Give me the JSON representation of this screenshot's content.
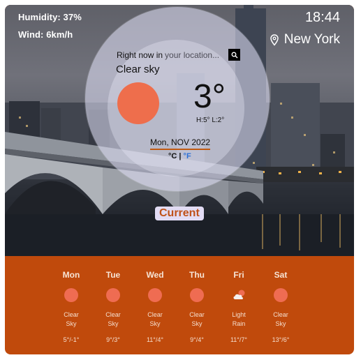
{
  "header": {
    "humidity": "Humidity: 37%",
    "wind": "Wind: 6km/h",
    "time": "18:44",
    "city": "New York",
    "location_icon": "map-pin-icon"
  },
  "current": {
    "search_label": "Right now in",
    "search_placeholder": "your location...",
    "search_icon": "search-icon",
    "condition": "Clear sky",
    "temperature": "3°",
    "hi_lo": "H:5° L:2°",
    "date": "Mon, NOV 2022",
    "unit_c": "°C",
    "unit_sep": "|",
    "unit_f": "°F",
    "button": "Current"
  },
  "colors": {
    "accent": "#c04a0c",
    "sun": "#ee6e4c",
    "unit_f": "#2b6fd6"
  },
  "forecast": [
    {
      "day": "Mon",
      "desc_1": "Clear",
      "desc_2": "Sky",
      "temp": "5°/-1°",
      "icon": "sun-icon"
    },
    {
      "day": "Tue",
      "desc_1": "Clear",
      "desc_2": "Sky",
      "temp": "9°/3°",
      "icon": "sun-icon"
    },
    {
      "day": "Wed",
      "desc_1": "Clear",
      "desc_2": "Sky",
      "temp": "11°/4°",
      "icon": "sun-icon"
    },
    {
      "day": "Thu",
      "desc_1": "Clear",
      "desc_2": "Sky",
      "temp": "9°/4°",
      "icon": "sun-icon"
    },
    {
      "day": "Fri",
      "desc_1": "Light",
      "desc_2": "Rain",
      "temp": "11°/7°",
      "icon": "cloud-sun-icon"
    },
    {
      "day": "Sat",
      "desc_1": "Clear",
      "desc_2": "Sky",
      "temp": "13°/6°",
      "icon": "sun-icon"
    }
  ]
}
